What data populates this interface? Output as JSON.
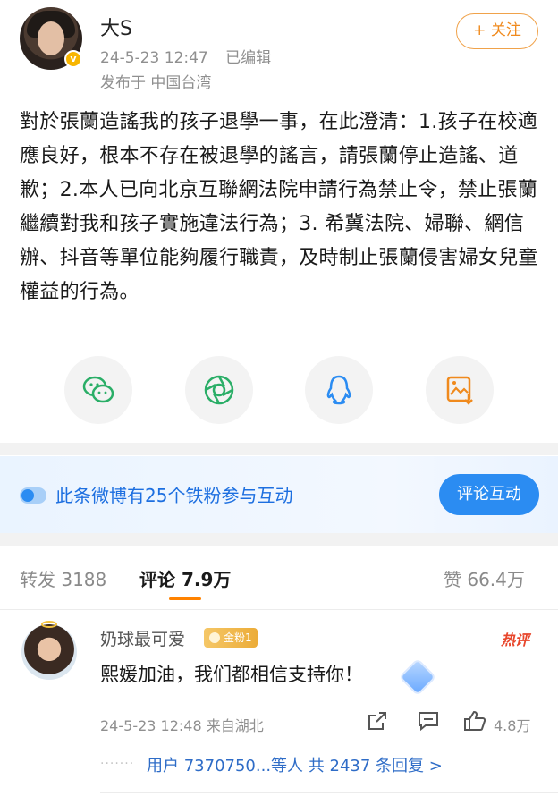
{
  "post": {
    "author": "大S",
    "timestamp": "24-5-23 12:47",
    "edited_label": "已编辑",
    "location": "发布于 中国台湾",
    "follow_label": "+ 关注",
    "text": "對於張蘭造謠我的孩子退學一事，在此澄清：1.孩子在校適應良好，根本不存在被退學的謠言，請張蘭停止造謠、道歉；2.本人已向北京互聯網法院申請行為禁止令，禁止張蘭繼續對我和孩子實施違法行為；3. 希冀法院、婦聯、網信辦、抖音等單位能夠履行職責，及時制止張蘭侵害婦女兒童權益的行為。"
  },
  "share": [
    {
      "icon": "wechat-icon",
      "color": "#2aae67"
    },
    {
      "icon": "moments-icon",
      "color": "#2aae67"
    },
    {
      "icon": "qq-icon",
      "color": "#2b8cf2"
    },
    {
      "icon": "save-image-icon",
      "color": "#f08a1d"
    }
  ],
  "fan_banner": {
    "text": "此条微博有25个铁粉参与互动",
    "button": "评论互动"
  },
  "tabs": {
    "repost_label": "转发",
    "repost_count": "3188",
    "comment_label": "评论",
    "comment_count": "7.9万",
    "like_label": "赞",
    "like_count": "66.4万"
  },
  "comment": {
    "name": "奶球最可爱",
    "badge": "金粉1",
    "hot_tag": "热评",
    "text": "熙媛加油，我们都相信支持你！",
    "meta": "24-5-23 12:48 来自湖北",
    "like_count": "4.8万",
    "replies_dots": "·······",
    "replies_text": "用户 7370750...等人  共 2437 条回复 >"
  }
}
